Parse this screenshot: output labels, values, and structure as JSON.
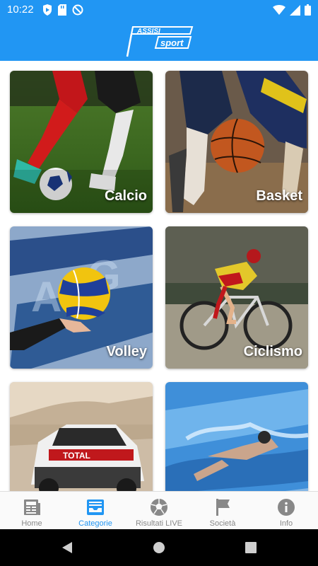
{
  "status_bar": {
    "time": "10:22",
    "left_icons": [
      "play-protect-icon",
      "sd-card-icon",
      "blocked-icon"
    ],
    "right_icons": [
      "wifi-icon",
      "signal-icon",
      "battery-icon"
    ]
  },
  "header": {
    "logo_text_top": "ASSISI",
    "logo_text_bottom": "sport",
    "background_color": "#2196f3"
  },
  "categories": [
    {
      "label": "Calcio",
      "image": "soccer-players-ball"
    },
    {
      "label": "Basket",
      "image": "basketball-players"
    },
    {
      "label": "Volley",
      "image": "volleyball-in-hand"
    },
    {
      "label": "Ciclismo",
      "image": "cyclist-racing"
    },
    {
      "label": "",
      "image": "rally-car"
    },
    {
      "label": "",
      "image": "swimmer-pool"
    }
  ],
  "bottom_nav": {
    "active_index": 1,
    "items": [
      {
        "label": "Home",
        "icon": "news-icon"
      },
      {
        "label": "Categorie",
        "icon": "inbox-tray-icon"
      },
      {
        "label": "Risultati LIVE",
        "icon": "soccer-ball-icon"
      },
      {
        "label": "Società",
        "icon": "flag-icon"
      },
      {
        "label": "Info",
        "icon": "info-icon"
      }
    ]
  },
  "system_nav": [
    "back-icon",
    "home-circle-icon",
    "recents-icon"
  ]
}
